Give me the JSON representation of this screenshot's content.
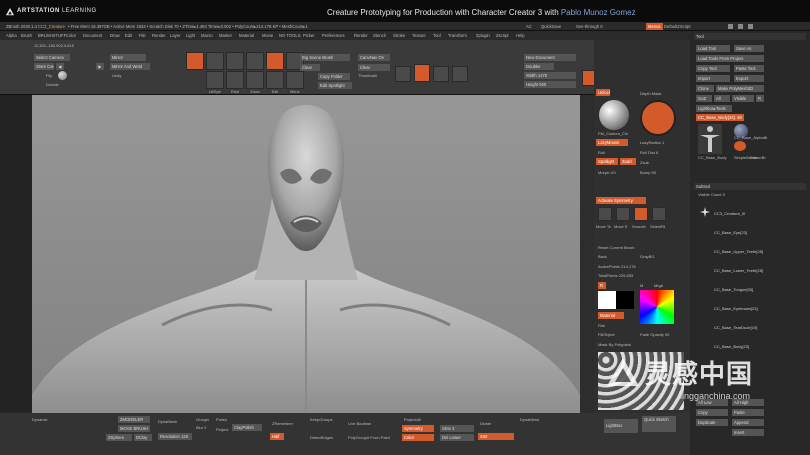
{
  "brand": {
    "name_bold": "ARTSTATION",
    "name_light": " LEARNING"
  },
  "course": {
    "title": "Creature Prototyping for Production with Character Creator 3",
    "with": " with ",
    "author": "Pablo Munoz Gomez"
  },
  "statusbar": {
    "app": "ZBrush 2020.1.4",
    "doc": "CC3_Creature",
    "mem": "• Free Mem 16.397GB • Active Mem 1934 • Scratch Disk 70 • ZTime▸1.494 Timer▸0.002 • PolyCount▸214.178 KP • MeshCount▸1",
    "ac": "AC",
    "quicksave": "QuickSave",
    "seethrough": "See-through 0",
    "menus": "Menus",
    "script": "DefaultZScript"
  },
  "menubar": [
    "Alpha",
    "Brush",
    "BRUSHSTUFF",
    "Color",
    "Document",
    "Draw",
    "Edit",
    "File",
    "Render",
    "Layer",
    "Light",
    "Macro",
    "Marker",
    "Material",
    "Movie",
    "NO TOOLS",
    "Picker",
    "Preferences",
    "Render",
    "Stencil",
    "Stroke",
    "Texture",
    "Tool",
    "Transform",
    "Zplugin",
    "Zscript",
    "Help"
  ],
  "coords": "11,301,-150.902,0.815",
  "shelf": {
    "select_camera": "Select Camera",
    "store_cam": "Store Cam",
    "flip": "Flip",
    "double": "Double",
    "mirror": "Mirror",
    "mirror_weld": "Mirror And Weld",
    "undo": "Undy",
    "icon_labels": [
      "Mirror",
      "LWSym",
      "Polyf",
      "Move",
      "Rotate",
      "Scale",
      "Draw",
      "Edit",
      "Zoom",
      "Frame"
    ],
    "big_scene_brush": "Big Scene Brush",
    "clear": "Clear",
    "copy_folder": "Copy Folder",
    "edit_spotlight": "Edit Spotlight",
    "canvas_nav": "CanvNav On",
    "thumbnail": "Thumbnail",
    "new_document": "New Document",
    "doubler": "Doubler",
    "width": "Width 1470",
    "height": "Height 920",
    "quick_render": "Quick Render Test",
    "bpr_to_3": "BPr To 3",
    "flat_to_sculpt": "Flat To Sculpt",
    "keyshot": "Keyshot",
    "groups_by_materials": "Groups By Materials"
  },
  "midpanel": {
    "unlocked": "Unlocked",
    "depth_mask": "Depth Mask",
    "matcap_label": "FM_Custom_Clo",
    "lazymouse": "LazyMouse",
    "lazyradius": "LazyRadius 1",
    "roll": "Roll",
    "roll_dist": "Roll Dist 6",
    "spotlight": "Spotlight",
    "zadd": "Zadd",
    "zsub": "Zsub",
    "morph_uv": "Morph UV",
    "bump": "Bump 90",
    "activate_symmetry": "Activate Symmetry",
    "brush_labels": [
      "Move Tc",
      "Move E",
      "Smooth",
      "SelectRt"
    ],
    "reset_current_brush": "Reset Current Brush",
    "back": "Back",
    "gray_bg": "GrayBG",
    "active_points": "ActivePoints 214,178",
    "total_points": "TotalPoints 229,653",
    "r": "R",
    "m": "M",
    "mrgb": "Mrgb",
    "fill_object": "FillObject",
    "material_label": "Material",
    "flat": "Flat",
    "fade_opacity": "Fade Opacity 90",
    "mask_by_polypaint": "Mask By Polypaint"
  },
  "tray": {
    "header": "Tool",
    "load_tool": "Load Tool",
    "save_as": "Save As",
    "load_from_project": "Load Tools From Project",
    "copy_tool": "Copy Tool",
    "paste_tool": "Paste Tool",
    "import": "Import",
    "export": "Export",
    "clone": "Clone",
    "make_polymesh": "Make PolyMesh3D",
    "goz": "GoZ",
    "all": "All",
    "visible": "Visible",
    "r": "R",
    "lightbox_tools": "Lightbox▸Tools",
    "current_tool": "CC_Base_Body[23]. 49",
    "thumb_labels": [
      "CC_Base_Body",
      "CC_Base_AlphaBr",
      "SimpleBrush",
      "EraserBr"
    ],
    "subtool": "Subtool",
    "visible_count": "Visible Count 9",
    "subtools": [
      "CC3_Creature_III",
      "CC_Base_Eye[23]",
      "CC_Base_Upper_Teeth[28]",
      "CC_Base_Lower_Teeth[28]",
      "CC_Base_Tongue[33]",
      "CC_Base_Eyebrows[23]",
      "CC_Base_TearDuctr[19]",
      "CC_Base_Body[23]"
    ],
    "all_low": "All Low",
    "all_high": "All High",
    "copy": "Copy",
    "paste": "Paste",
    "duplicate": "Duplicate",
    "append": "Append",
    "insert": "Insert"
  },
  "bottom": {
    "dynamic": "Dynamic",
    "zmodeler": "ZMODELER",
    "move_brush": "MOVE BRUSH",
    "dynamesh": "DynaMesh",
    "zsphere": "ZSphere",
    "dclay": "DClay",
    "groups": "Groups",
    "polish": "Polish",
    "blur": "Blur 2",
    "project": "Project",
    "clay_polish": "ClayPolish",
    "resolution": "Resolution 128",
    "zremesher": "ZRemesher",
    "half": "Half",
    "keep_groups": "KeepGroups",
    "detect_edges": "DetectEdges",
    "live_boolean": "Live Boolean",
    "polygroup_paint": "PolyGroupIt From Paint",
    "projection": "ProjectAll",
    "symmetry": "Symmetry",
    "color": "Color",
    "sdiv": "SDiv 3",
    "del_lower": "Del Lower",
    "divide": "Divide",
    "smt": "Smt",
    "dynmesh_left": "DynaMesh",
    "lightbox": "LightBox",
    "quick_sketch": "Quick Sketch"
  },
  "watermark": {
    "cn": "灵感中国",
    "url": "lingganchina.com"
  }
}
